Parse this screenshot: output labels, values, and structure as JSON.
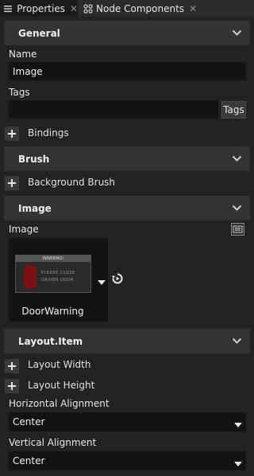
{
  "tabs": [
    {
      "label": "Properties",
      "icon": "list-icon",
      "active": true
    },
    {
      "label": "Node Components",
      "icon": "components-icon",
      "active": false
    }
  ],
  "general": {
    "title": "General",
    "name_label": "Name",
    "name_value": "Image",
    "tags_label": "Tags",
    "tags_value": "",
    "tags_button": "Tags",
    "bindings_label": "Bindings"
  },
  "brush": {
    "title": "Brush",
    "background_brush_label": "Background Brush"
  },
  "image": {
    "title": "Image",
    "image_label": "Image",
    "preview_header": "WARNING!",
    "preview_message_line1": "PLEASE CLOSE",
    "preview_message_line2": "DRIVER DOOR",
    "asset_name": "DoorWarning"
  },
  "layout_item": {
    "title": "Layout.Item",
    "layout_width_label": "Layout Width",
    "layout_height_label": "Layout Height",
    "horizontal_alignment_label": "Horizontal Alignment",
    "horizontal_alignment_value": "Center",
    "vertical_alignment_label": "Vertical Alignment",
    "vertical_alignment_value": "Center"
  },
  "colors": {
    "panel_bg": "#222222",
    "section_bg": "#333333",
    "field_bg": "#131313"
  }
}
